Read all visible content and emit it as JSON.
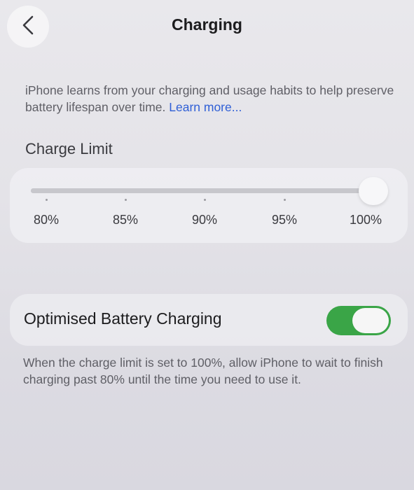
{
  "nav": {
    "title": "Charging",
    "back_icon": "chevron-left-icon"
  },
  "intro": {
    "text": "iPhone learns from your charging and usage habits to help preserve battery lifespan over time.",
    "link": "Learn more..."
  },
  "charge_limit": {
    "header": "Charge Limit",
    "ticks": [
      "80%",
      "85%",
      "90%",
      "95%",
      "100%"
    ],
    "selected": "100%",
    "selected_fraction": 1.0
  },
  "optimised": {
    "label": "Optimised Battery Charging",
    "on": true,
    "footer": "When the charge limit is set to 100%, allow iPhone to wait to finish charging past 80% until the time you need to use it."
  },
  "colors": {
    "toggle_on": "#3aa547",
    "link": "#2f5fd6"
  }
}
